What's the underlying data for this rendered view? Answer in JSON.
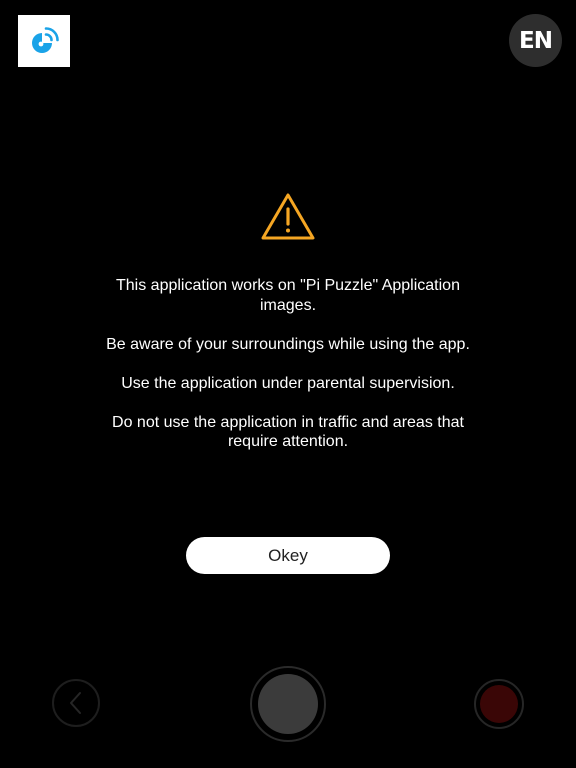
{
  "header": {
    "logo_icon": "pi-puzzle-logo-icon",
    "language_label": "EN"
  },
  "dialog": {
    "icon": "warning-triangle-icon",
    "messages": [
      "This application works on \"Pi Puzzle\" Application images.",
      "Be aware of your surroundings while using the app.",
      "Use the application under parental supervision.",
      "Do not use the application in traffic and areas that require attention."
    ],
    "button_label": "Okey"
  },
  "controls": {
    "back_icon": "chevron-left-icon",
    "shutter_icon": "shutter-icon",
    "record_icon": "record-icon"
  },
  "colors": {
    "background": "#000000",
    "warning": "#f5a623",
    "logo_blue": "#1aa3e8",
    "record": "#3a0606"
  }
}
